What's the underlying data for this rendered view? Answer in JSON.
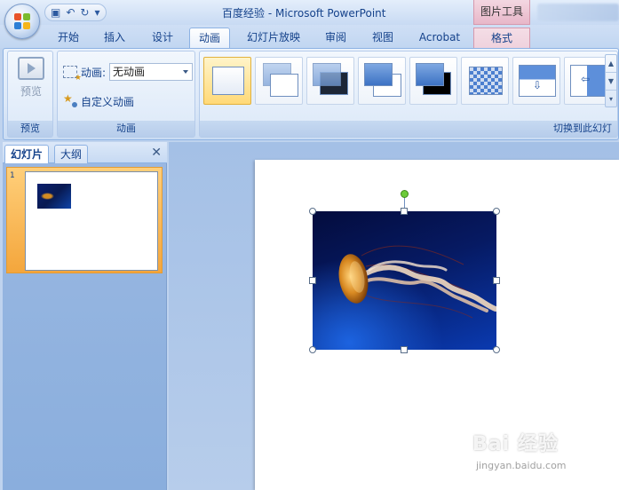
{
  "window": {
    "title": "百度经验 - Microsoft PowerPoint",
    "context_tool_title": "图片工具"
  },
  "qat": {
    "save_icon": "save-icon",
    "undo_icon": "undo-icon",
    "redo_icon": "redo-icon"
  },
  "tabs": [
    {
      "label": "开始"
    },
    {
      "label": "插入"
    },
    {
      "label": "设计"
    },
    {
      "label": "动画",
      "active": true
    },
    {
      "label": "幻灯片放映"
    },
    {
      "label": "审阅"
    },
    {
      "label": "视图"
    },
    {
      "label": "Acrobat"
    },
    {
      "label": "格式",
      "context": true
    }
  ],
  "ribbon": {
    "preview_group": {
      "button_label": "预览",
      "group_label": "预览"
    },
    "animation_group": {
      "animation_label": "动画:",
      "animation_value": "无动画",
      "custom_animation_label": "自定义动画",
      "group_label": "动画"
    },
    "transition_group": {
      "group_label": "切换到此幻灯"
    }
  },
  "panel": {
    "tab_slides": "幻灯片",
    "tab_outline": "大纲",
    "close_icon": "close-icon",
    "slide_number": "1"
  },
  "watermark": {
    "main": "Bai 经验",
    "sub": "jingyan.baidu.com"
  },
  "colors": {
    "ribbon_bg": "#dde9f8",
    "selected_tab": "#ffffff",
    "context_tab": "#efd2dd",
    "selection_gold": "#ffd978",
    "rotate_handle": "#6ccb3a"
  }
}
